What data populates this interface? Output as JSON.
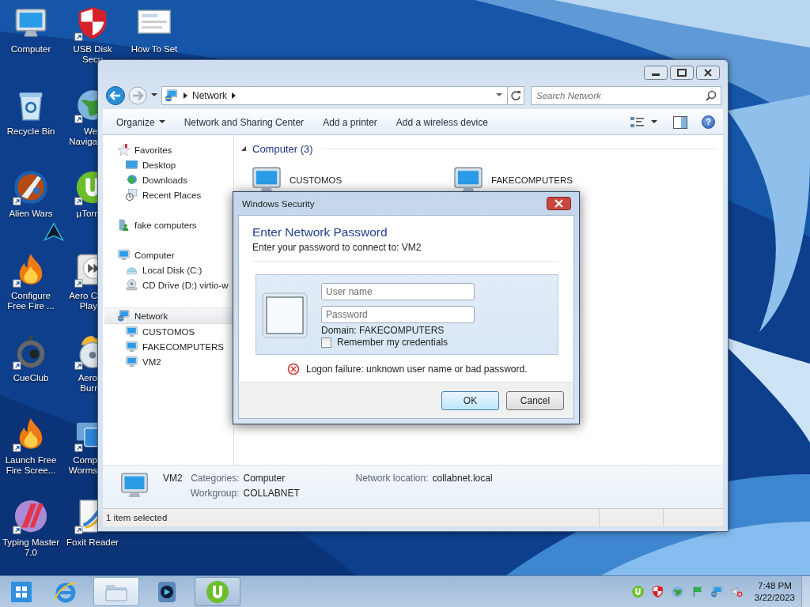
{
  "desktop_icons": [
    {
      "kind": "computer",
      "label": "Computer",
      "shortcut": false
    },
    {
      "kind": "recycle",
      "label": "Recycle Bin",
      "shortcut": false
    },
    {
      "kind": "game",
      "label": "Alien Wars",
      "shortcut": true
    },
    {
      "kind": "flame",
      "label": "Configure Free Fire ...",
      "shortcut": true
    },
    {
      "kind": "cue",
      "label": "CueClub",
      "shortcut": true
    },
    {
      "kind": "flame",
      "label": "Launch Free Fire Scree...",
      "shortcut": true
    },
    {
      "kind": "typing",
      "label": "Typing Master 7.0",
      "shortcut": true
    },
    {
      "kind": "shield",
      "label": "USB Disk Secu",
      "shortcut": true
    },
    {
      "kind": "globe",
      "label": "We Naviga",
      "shortcut": true
    },
    {
      "kind": "torrent",
      "label": "µTorr",
      "shortcut": true
    },
    {
      "kind": "widget",
      "label": "Aero C Play",
      "shortcut": true
    },
    {
      "kind": "disc",
      "label": "Aero Burr",
      "shortcut": true
    },
    {
      "kind": "worms",
      "label": "Comp Worms",
      "shortcut": true
    },
    {
      "kind": "pdf",
      "label": "Foxit Reader",
      "shortcut": true
    },
    {
      "kind": "document",
      "label": "How To Set",
      "shortcut": false
    }
  ],
  "explorer": {
    "address": {
      "crumbs": [
        "Network"
      ]
    },
    "search": {
      "placeholder": "Search Network"
    },
    "toolbar": {
      "commands": [
        {
          "label": "Organize",
          "dropdown": true
        },
        {
          "label": "Network and Sharing Center",
          "dropdown": false
        },
        {
          "label": "Add a printer",
          "dropdown": false
        },
        {
          "label": "Add a wireless device",
          "dropdown": false
        }
      ],
      "help": "?"
    },
    "nav": [
      {
        "kind": "star",
        "label": "Favorites",
        "selected": false,
        "children": [
          {
            "kind": "desktop",
            "label": "Desktop",
            "selected": false
          },
          {
            "kind": "downloads",
            "label": "Downloads",
            "selected": false
          },
          {
            "kind": "recent",
            "label": "Recent Places",
            "selected": false
          }
        ]
      },
      {
        "kind": "usershare",
        "label": "fake computers",
        "selected": false
      },
      {
        "kind": "computer",
        "label": "Computer",
        "selected": false,
        "children": [
          {
            "kind": "disk",
            "label": "Local Disk (C:)",
            "selected": false
          },
          {
            "kind": "cd",
            "label": "CD Drive (D:) virtio-w",
            "selected": false
          }
        ]
      },
      {
        "kind": "network",
        "label": "Network",
        "selected": true,
        "children": [
          {
            "kind": "computer",
            "label": "CUSTOMOS",
            "selected": false
          },
          {
            "kind": "computer",
            "label": "FAKECOMPUTERS",
            "selected": false
          },
          {
            "kind": "computer",
            "label": "VM2",
            "selected": false
          }
        ]
      }
    ],
    "content": {
      "groups": [
        {
          "label": "Computer (3)",
          "expanded": true,
          "items": [
            {
              "kind": "computer",
              "label": "CUSTOMOS"
            },
            {
              "kind": "computer",
              "label": "FAKECOMPUTERS"
            }
          ]
        }
      ]
    },
    "details": {
      "kind": "computer",
      "name": "VM2",
      "fields": [
        {
          "label": "Categories:",
          "value": "Computer"
        },
        {
          "label": "Workgroup:",
          "value": "COLLABNET"
        },
        {
          "label": "Network location:",
          "value": "collabnet.local"
        }
      ]
    },
    "status_bar": {
      "text": "1 item selected"
    }
  },
  "dialog": {
    "title": "Windows Security",
    "heading": "Enter Network Password",
    "subheading": "Enter your password to connect to: VM2",
    "fields": [
      {
        "placeholder": "User name"
      },
      {
        "placeholder": "Password"
      }
    ],
    "domain": "Domain: FAKECOMPUTERS",
    "remember": {
      "label": "Remember my credentials",
      "checked": false
    },
    "error": "Logon failure: unknown user name or bad password.",
    "buttons": [
      {
        "label": "OK",
        "default": true
      },
      {
        "label": "Cancel",
        "default": false
      }
    ]
  },
  "taskbar": {
    "apps": [
      {
        "kind": "ie",
        "running": false,
        "selected": false
      },
      {
        "kind": "explorer",
        "running": true,
        "selected": true
      },
      {
        "kind": "media",
        "running": false,
        "selected": false
      },
      {
        "kind": "torrent",
        "running": true,
        "selected": false
      }
    ],
    "tray": [
      {
        "kind": "torrent"
      },
      {
        "kind": "shield"
      },
      {
        "kind": "globe"
      },
      {
        "kind": "flag"
      },
      {
        "kind": "network"
      },
      {
        "kind": "muted"
      }
    ],
    "clock": {
      "time": "7:48 PM",
      "date": "3/22/2023"
    }
  }
}
